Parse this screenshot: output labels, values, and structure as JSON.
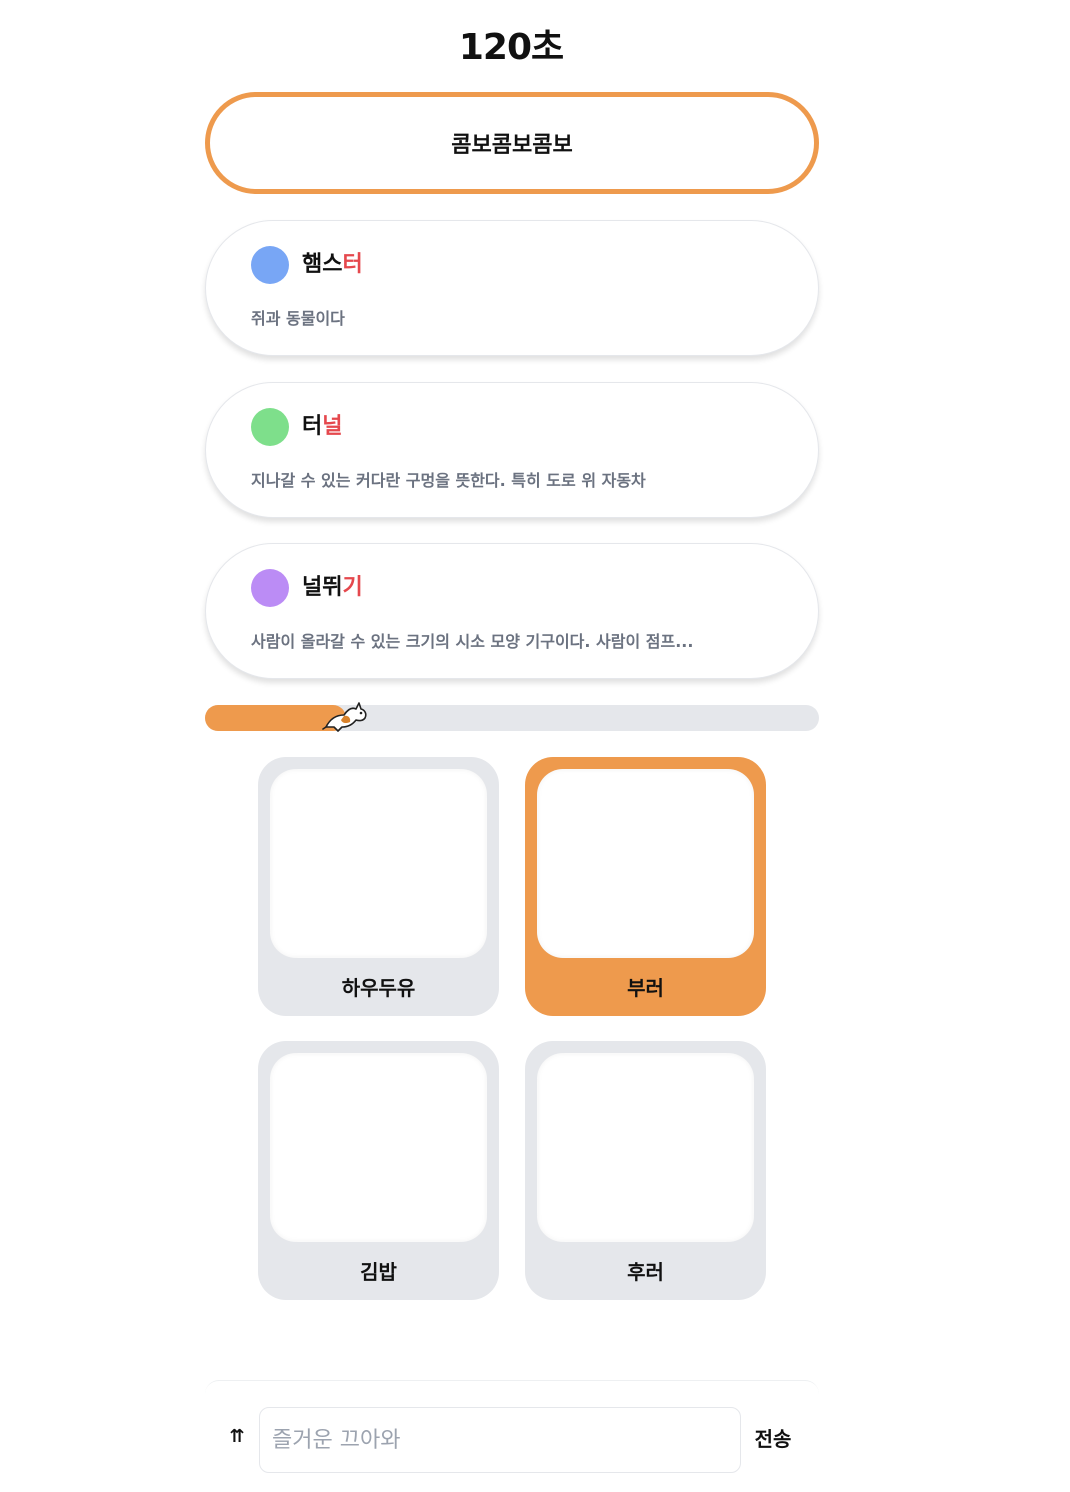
{
  "timer": {
    "text": "120초"
  },
  "combo": {
    "text": "콤보콤보콤보"
  },
  "words": [
    {
      "prefix": "햄스",
      "highlight": "터",
      "description": "쥐과 동물이다",
      "dot_color": "#78a6f5"
    },
    {
      "prefix": "터",
      "highlight": "널",
      "description": "지나갈 수 있는 커다란 구멍을 뜻한다. 특히 도로 위 자동차",
      "dot_color": "#7edf8b"
    },
    {
      "prefix": "널뛰",
      "highlight": "기",
      "description": "사람이 올라갈 수 있는 크기의 시소 모양 기구이다. 사람이 점프...",
      "dot_color": "#bb8cf5"
    }
  ],
  "progress": {
    "value": 0.23,
    "fill_color": "#ee9a4d",
    "runner_icon": "running-cat-icon"
  },
  "options": [
    {
      "label": "하우두유",
      "selected": false
    },
    {
      "label": "부러",
      "selected": true
    },
    {
      "label": "김밥",
      "selected": false
    },
    {
      "label": "후러",
      "selected": false
    }
  ],
  "input_bar": {
    "swap_icon": "⇈",
    "placeholder": "즐거운 끄아와",
    "send_label": "전송"
  },
  "colors": {
    "accent": "#ee9a4d",
    "highlight": "#e5484d",
    "muted": "#6b7280",
    "panel": "#e5e7eb"
  }
}
